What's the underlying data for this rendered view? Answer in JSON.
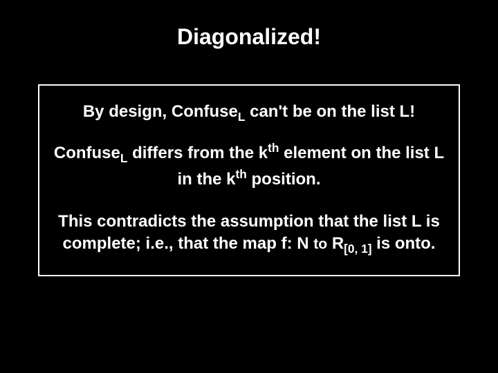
{
  "title": "Diagonalized!",
  "p1": {
    "a": "By design, Confuse",
    "subL": "L",
    "b": " can't be on the list L!"
  },
  "p2": {
    "a": "Confuse",
    "subL1": "L",
    "b": " differs from the k",
    "supth1": "th",
    "c": " element on the list L in the k",
    "supth2": "th",
    "d": " position."
  },
  "p3": {
    "a": "This contradicts the assumption that the list L is complete; i.e., that the map f: N ",
    "b": "to",
    "c": " R",
    "sub01": "[0, 1]",
    "d": " is onto."
  }
}
